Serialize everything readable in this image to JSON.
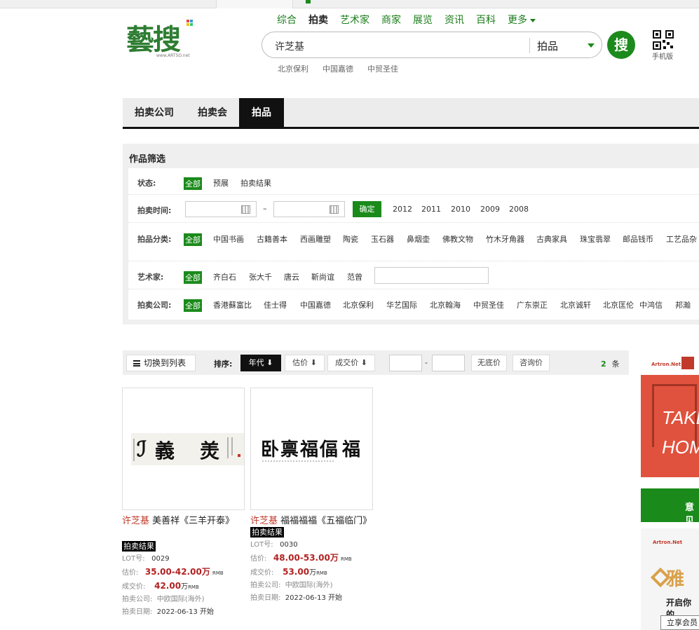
{
  "logo": {
    "text": "藝搜",
    "url": "www.ARTSO.net"
  },
  "nav": {
    "items": [
      "综合",
      "拍卖",
      "艺术家",
      "商家",
      "展览",
      "资讯",
      "百科"
    ],
    "more": "更多"
  },
  "search": {
    "query": "许芝基",
    "category": "拍品",
    "button": "搜",
    "mobile_label": "手机版",
    "hot_words": [
      "北京保利",
      "中国嘉德",
      "中贸圣佳"
    ]
  },
  "tabs": [
    "拍卖公司",
    "拍卖会",
    "拍品"
  ],
  "filter": {
    "title": "作品筛选",
    "status": {
      "label": "状态:",
      "options": [
        "全部",
        "预展",
        "拍卖结果"
      ]
    },
    "time": {
      "label": "拍卖时间:",
      "dash": "–",
      "confirm": "确定",
      "years": [
        "2012",
        "2011",
        "2010",
        "2009",
        "2008"
      ]
    },
    "category": {
      "label": "拍品分类:",
      "options": [
        "全部",
        "中国书画",
        "古籍善本",
        "西画雕塑",
        "陶瓷",
        "玉石器",
        "鼻烟壶",
        "佛教文物",
        "竹木牙角器",
        "古典家具",
        "珠宝翡翠",
        "邮品钱币",
        "工艺品杂"
      ]
    },
    "artist": {
      "label": "艺术家:",
      "options": [
        "全部",
        "齐白石",
        "张大千",
        "唐云",
        "靳尚谊",
        "范曾"
      ]
    },
    "company": {
      "label": "拍卖公司:",
      "options": [
        "全部",
        "香港蘇富比",
        "佳士得",
        "中国嘉德",
        "北京保利",
        "华艺国际",
        "北京翰海",
        "中贸圣佳",
        "广东崇正",
        "北京诚轩",
        "北京匡伦",
        "中鸿信",
        "邦瀚"
      ]
    }
  },
  "toolbar": {
    "switch_label": "切换到列表",
    "sort_label": "排序:",
    "sorts": [
      "年代 ⬇",
      "估价 ⬇",
      "成交价 ⬇"
    ],
    "range_dash": "-",
    "no_reserve": "无底价",
    "inquiry": "咨询价",
    "count": "2",
    "count_unit": "条"
  },
  "lots": [
    {
      "artist": "许芝基",
      "title": "美善祥《三羊开泰》",
      "badge": "拍卖结果",
      "lot_label": "LOT号:",
      "lot": "0029",
      "estimate_label": "估价:",
      "estimate": "35.00-42.00万",
      "sold_label": "成交价:",
      "sold": "42.00",
      "sold_unit": "万",
      "currency": "RMB",
      "company_label": "拍卖公司:",
      "company": "中欧国际(海外)",
      "date_label": "拍卖日期:",
      "date": "2022-06-13 开始"
    },
    {
      "artist": "许芝基",
      "title": "福福福福《五福临门》",
      "badge": "拍卖结果",
      "lot_label": "LOT号:",
      "lot": "0030",
      "estimate_label": "估价:",
      "estimate": "48.00-53.00万",
      "sold_label": "成交价:",
      "sold": "53.00",
      "sold_unit": "万",
      "currency": "RMB",
      "company_label": "拍卖公司:",
      "company": "中欧国际(海外)",
      "date_label": "拍卖日期:",
      "date": "2022-06-13 开始"
    }
  ],
  "ads": {
    "brand": "Artron.Net",
    "ad1_text1": "TAKE",
    "ad1_text2": "HOM",
    "ad2_text": "意见",
    "ad3_title": "雅",
    "ad3_sub": "开启你的",
    "ad3_button": "立享会员"
  },
  "colors": {
    "brand_green": "#1a8a1a",
    "artist_red": "#c0392b",
    "price_red": "#b22222"
  }
}
